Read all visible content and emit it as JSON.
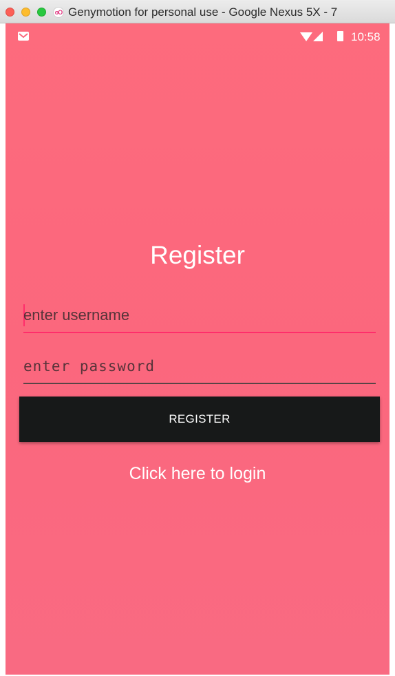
{
  "window": {
    "title": "Genymotion for personal use - Google Nexus 5X - 7",
    "app_icon_glyph": "oO"
  },
  "statusbar": {
    "time": "10:58",
    "icons": [
      "gmail-icon",
      "wifi-icon",
      "signal-icon",
      "battery-icon"
    ]
  },
  "form": {
    "title": "Register",
    "username": {
      "value": "",
      "placeholder": "enter username"
    },
    "password": {
      "value": "",
      "placeholder": "enter password"
    },
    "register_label": "REGISTER",
    "login_link": "Click here to login"
  },
  "colors": {
    "background": "#fb687d",
    "accent": "#ff2d6b",
    "button": "#171919"
  }
}
